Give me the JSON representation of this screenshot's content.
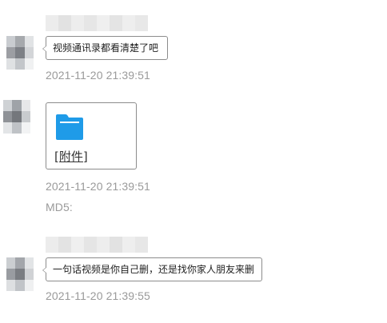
{
  "messages": [
    {
      "text": "视频通讯录都看清楚了吧",
      "timestamp": "2021-11-20 21:39:51"
    },
    {
      "attachment_label": "[附件]",
      "timestamp": "2021-11-20 21:39:51",
      "md5_label": "MD5:"
    },
    {
      "text": "一句话视频是你自己删，还是找你家人朋友来删",
      "timestamp": "2021-11-20 21:39:55"
    }
  ],
  "colors": {
    "folder": "#1f9be8",
    "timestamp": "#9a9a9a",
    "border": "#8c8c8c"
  },
  "icons": {
    "attachment": "folder-icon"
  }
}
